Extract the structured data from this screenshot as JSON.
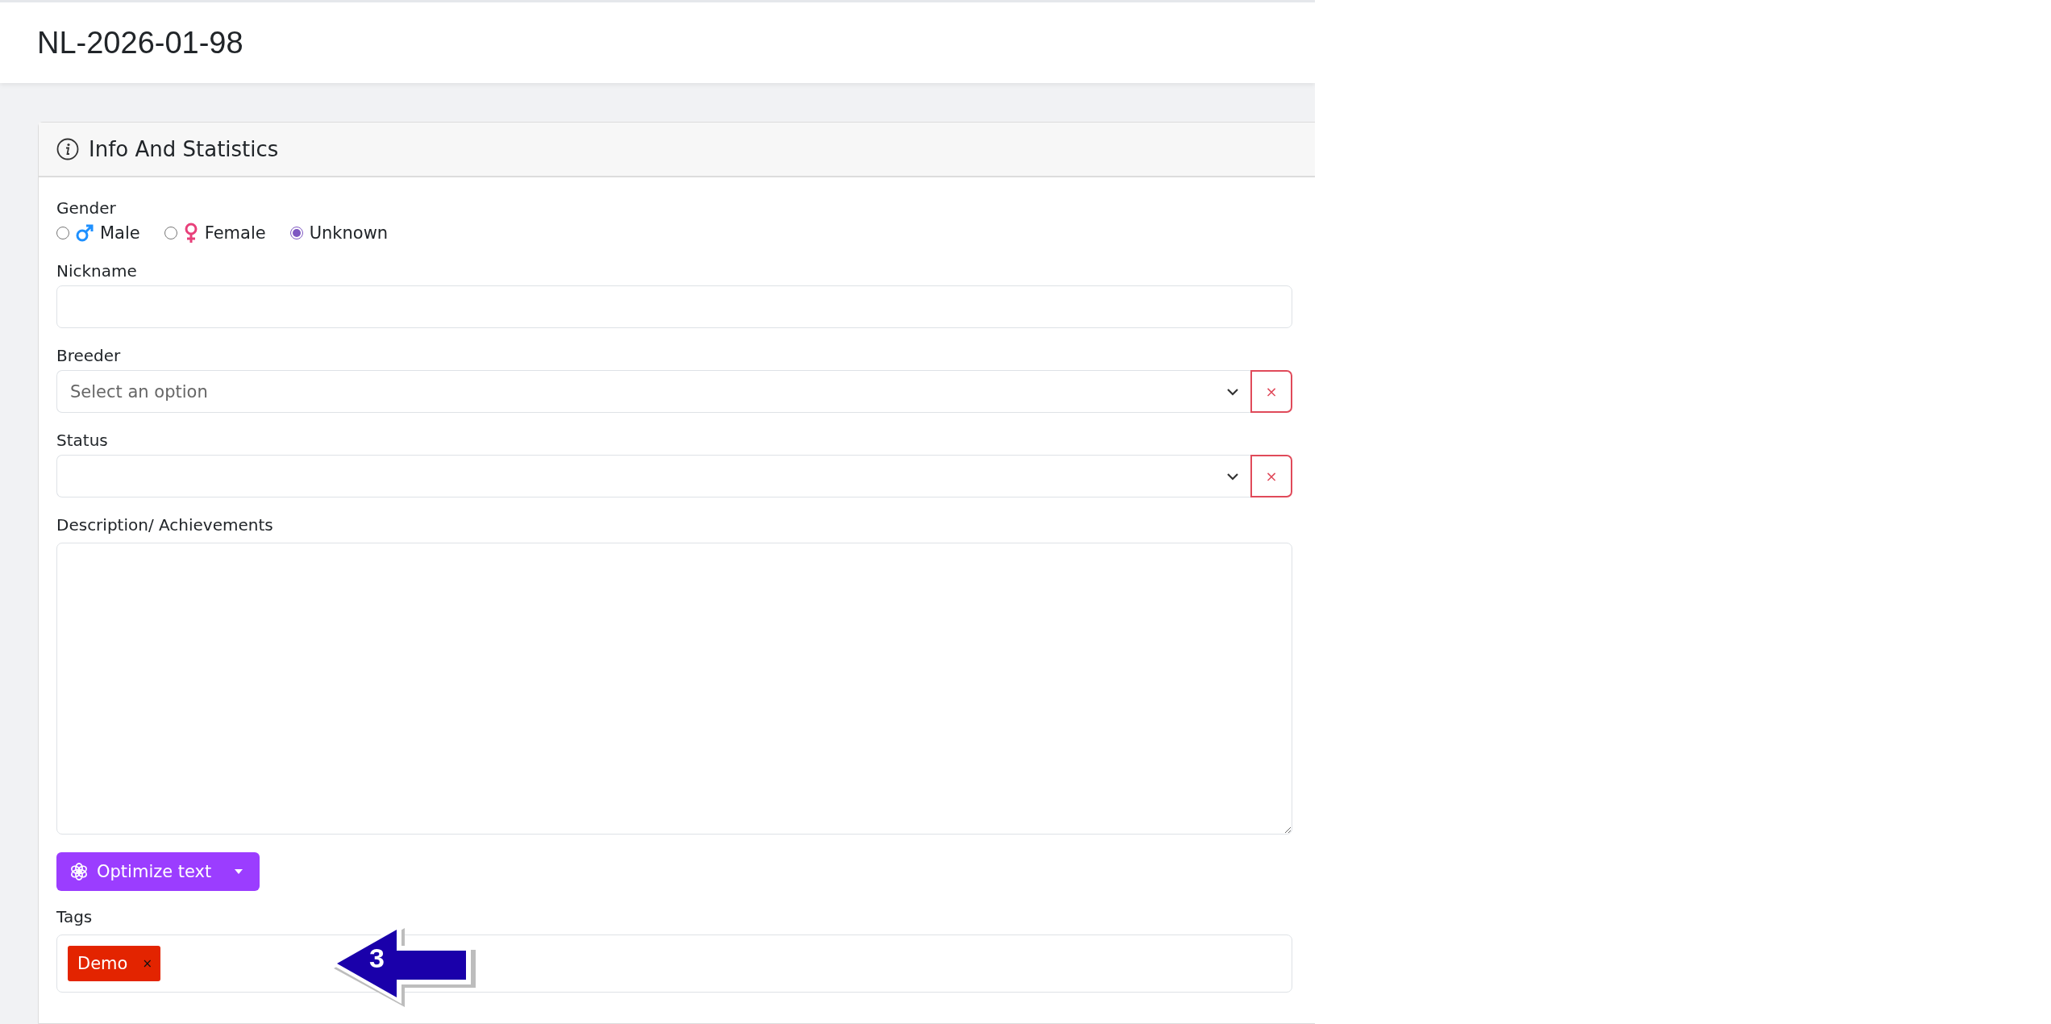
{
  "page_title": "NL-2026-01-98",
  "card": {
    "title": "Info And Statistics"
  },
  "gender": {
    "label": "Gender",
    "options": [
      {
        "label": "Male",
        "kind": "male",
        "selected": false
      },
      {
        "label": "Female",
        "kind": "female",
        "selected": false
      },
      {
        "label": "Unknown",
        "kind": "none",
        "selected": true
      }
    ]
  },
  "fields": [
    {
      "kind": "text",
      "label": "Nickname"
    },
    {
      "kind": "select",
      "label": "Breeder",
      "placeholder": "Select an option",
      "clear": "×"
    },
    {
      "kind": "select",
      "label": "Status",
      "clear": "×"
    },
    {
      "kind": "textarea",
      "label": "Description/ Achievements"
    }
  ],
  "optimize_button": {
    "label": "Optimize text"
  },
  "tags": {
    "label": "Tags",
    "items": [
      {
        "label": "Demo",
        "remove": "×"
      }
    ]
  },
  "callout": {
    "label": "3"
  }
}
